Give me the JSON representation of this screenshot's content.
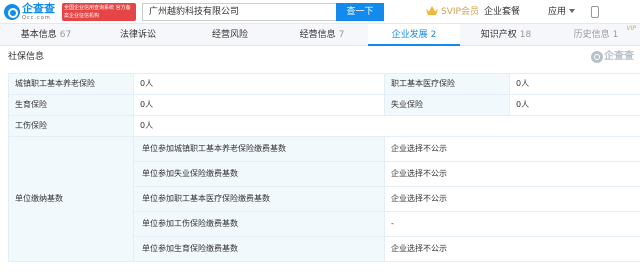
{
  "header": {
    "logo_name": "企查查",
    "logo_domain": "Qcc.com",
    "cert_text": "全国企业信用查询系统 官方备案企业征信机构",
    "search_value": "广州越豹科技有限公司",
    "search_button": "查一下",
    "svip_label": "SVIP会员",
    "nav": [
      "企业套餐",
      "应用"
    ]
  },
  "tabs": [
    {
      "label": "基本信息",
      "count": "67"
    },
    {
      "label": "法律诉讼",
      "count": ""
    },
    {
      "label": "经营风险",
      "count": ""
    },
    {
      "label": "经营信息",
      "count": "7"
    },
    {
      "label": "企业发展",
      "count": "2"
    },
    {
      "label": "知识产权",
      "count": "18"
    },
    {
      "label": "历史信息",
      "count": "1",
      "badge": "VIP"
    }
  ],
  "section": {
    "title": "社保信息",
    "watermark": "企查查"
  },
  "table": {
    "rows": [
      {
        "l1": "城镇职工基本养老保险",
        "v1": "0人",
        "l2": "职工基本医疗保险",
        "v2": "0人"
      },
      {
        "l1": "生育保险",
        "v1": "0人",
        "l2": "失业保险",
        "v2": "0人"
      },
      {
        "l1": "工伤保险",
        "v1": "0人"
      }
    ],
    "base_label": "单位缴纳基数",
    "base_rows": [
      {
        "item": "单位参加城镇职工基本养老保险缴费基数",
        "value": "企业选择不公示"
      },
      {
        "item": "单位参加失业保险缴费基数",
        "value": "企业选择不公示"
      },
      {
        "item": "单位参加职工基本医疗保险缴费基数",
        "value": "企业选择不公示"
      },
      {
        "item": "单位参加工伤保险缴费基数",
        "value": "-"
      },
      {
        "item": "单位参加生育保险缴费基数",
        "value": "企业选择不公示"
      }
    ]
  }
}
